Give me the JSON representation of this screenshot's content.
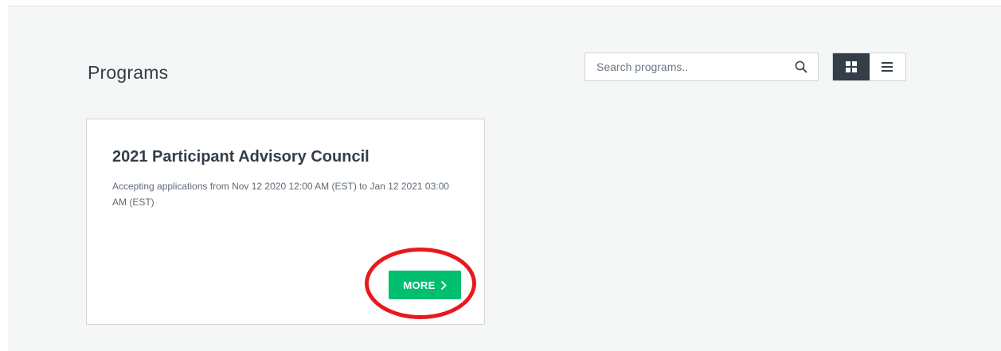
{
  "page": {
    "title": "Programs"
  },
  "search": {
    "placeholder": "Search programs..",
    "icon": "search-icon"
  },
  "view_toggle": {
    "options": [
      "grid-view",
      "list-view"
    ],
    "selected": "grid-view",
    "active_color": "#333e48"
  },
  "programs": [
    {
      "title": "2021 Participant Advisory Council",
      "description": "Accepting applications from Nov 12 2020 12:00 AM (EST) to Jan 12 2021 03:00 AM (EST)",
      "button_label": "MORE",
      "button_icon": "chevron-right-icon",
      "button_color": "#00bf6f"
    }
  ],
  "annotation": {
    "type": "highlight-circle",
    "color": "#e8191d",
    "target": "more-button"
  }
}
